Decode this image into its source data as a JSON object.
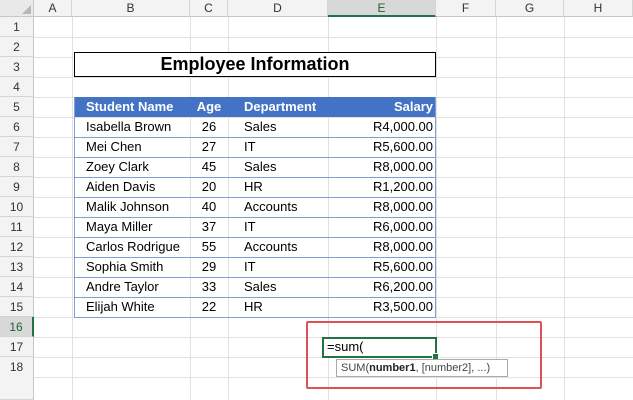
{
  "columns": [
    "A",
    "B",
    "C",
    "D",
    "E",
    "F",
    "G",
    "H"
  ],
  "rows": [
    "1",
    "2",
    "3",
    "4",
    "5",
    "6",
    "7",
    "8",
    "9",
    "10",
    "11",
    "12",
    "13",
    "14",
    "15",
    "16",
    "17",
    "18"
  ],
  "title": "Employee Information",
  "headers": {
    "name": "Student Name",
    "age": "Age",
    "dept": "Department",
    "salary": "Salary"
  },
  "employees": [
    {
      "name": "Isabella Brown",
      "age": "26",
      "dept": "Sales",
      "salary": "R4,000.00"
    },
    {
      "name": "Mei Chen",
      "age": "27",
      "dept": "IT",
      "salary": "R5,600.00"
    },
    {
      "name": "Zoey Clark",
      "age": "45",
      "dept": "Sales",
      "salary": "R8,000.00"
    },
    {
      "name": "Aiden Davis",
      "age": "20",
      "dept": "HR",
      "salary": "R1,200.00"
    },
    {
      "name": "Malik Johnson",
      "age": "40",
      "dept": "Accounts",
      "salary": "R8,000.00"
    },
    {
      "name": "Maya Miller",
      "age": "37",
      "dept": "IT",
      "salary": "R6,000.00"
    },
    {
      "name": "Carlos Rodrigue",
      "age": "55",
      "dept": "Accounts",
      "salary": "R8,000.00"
    },
    {
      "name": "Sophia Smith",
      "age": "29",
      "dept": "IT",
      "salary": "R5,600.00"
    },
    {
      "name": "Andre Taylor",
      "age": "33",
      "dept": "Sales",
      "salary": "R6,200.00"
    },
    {
      "name": "Elijah White",
      "age": "22",
      "dept": "HR",
      "salary": "R3,500.00"
    }
  ],
  "active_cell": {
    "column": "E",
    "row": "16",
    "formula": "=sum("
  },
  "tooltip": {
    "func": "SUM(",
    "arg1": "number1",
    "rest": ", [number2], ...)"
  },
  "colors": {
    "header_fill": "#4472c4",
    "selection": "#217346",
    "highlight_box": "#e05252"
  }
}
